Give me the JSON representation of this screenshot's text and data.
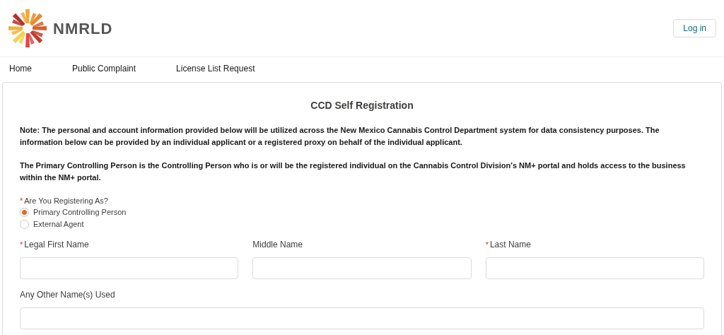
{
  "header": {
    "logo_text": "NMRLD",
    "login_button": "Log in"
  },
  "nav": [
    {
      "label": "Home"
    },
    {
      "label": "Public Complaint"
    },
    {
      "label": "License List Request"
    }
  ],
  "form": {
    "title": "CCD Self Registration",
    "notes": [
      "Note:  The personal and account information provided below will be utilized across the New Mexico Cannabis Control Department system for data consistency purposes. The information below can be provided by an individual applicant or a registered proxy on behalf of the individual applicant.",
      "The Primary Controlling Person is the Controlling Person who is or will be the registered individual on the Cannabis Control Division's NM+ portal and holds access to the business within the NM+ portal."
    ],
    "question": {
      "marker": "*",
      "label": "Are You Registering As?",
      "options": [
        {
          "label": "Primary Controlling Person",
          "selected": true
        },
        {
          "label": "External Agent",
          "selected": false
        }
      ]
    },
    "name_fields": [
      {
        "marker": "*",
        "label": "Legal First Name"
      },
      {
        "label": "Middle Name"
      },
      {
        "marker": "*",
        "label": "Last Name"
      }
    ],
    "other_field": {
      "label": "Any Other Name(s) Used"
    }
  }
}
